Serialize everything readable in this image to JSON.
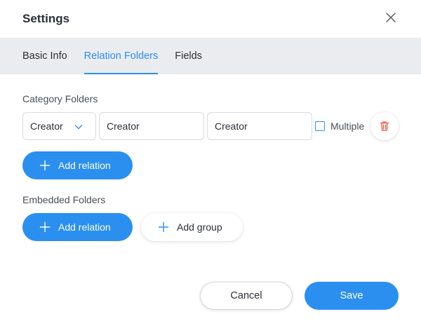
{
  "dialog": {
    "title": "Settings",
    "close_icon": "close-icon"
  },
  "tabs": [
    {
      "label": "Basic Info",
      "active": false
    },
    {
      "label": "Relation Folders",
      "active": true
    },
    {
      "label": "Fields",
      "active": false
    }
  ],
  "category": {
    "label": "Category Folders",
    "select_value": "Creator",
    "input1_value": "Creator",
    "input2_value": "Creator",
    "multiple_label": "Multiple",
    "multiple_checked": false,
    "add_relation_label": "Add relation"
  },
  "embedded": {
    "label": "Embedded Folders",
    "add_relation_label": "Add relation",
    "add_group_label": "Add group"
  },
  "footer": {
    "cancel_label": "Cancel",
    "save_label": "Save"
  },
  "colors": {
    "accent": "#2b8ff0",
    "tabbar_bg": "#ebecf0",
    "danger": "#e5533d"
  }
}
